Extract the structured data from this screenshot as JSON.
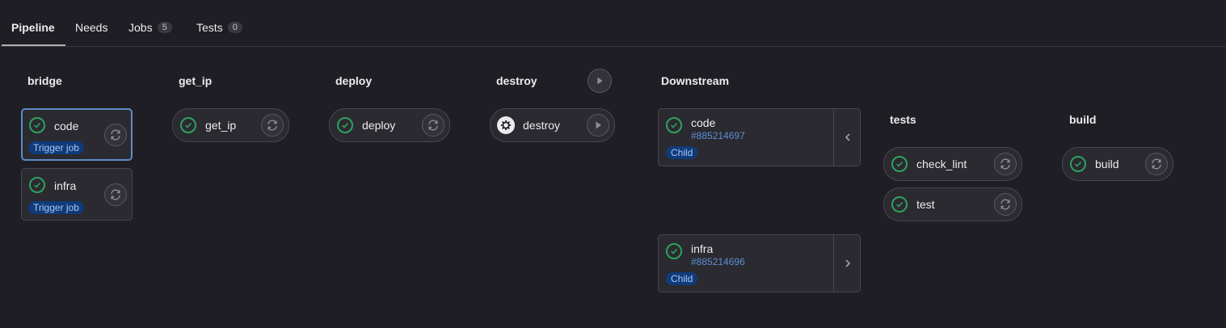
{
  "tabs": [
    {
      "label": "Pipeline"
    },
    {
      "label": "Needs"
    },
    {
      "label": "Jobs",
      "count": "5"
    },
    {
      "label": "Tests",
      "count": "0"
    }
  ],
  "stages": {
    "bridge": {
      "title": "bridge",
      "jobs": [
        {
          "name": "code",
          "badge": "Trigger job"
        },
        {
          "name": "infra",
          "badge": "Trigger job"
        }
      ]
    },
    "get_ip": {
      "title": "get_ip",
      "jobs": [
        {
          "name": "get_ip"
        }
      ]
    },
    "deploy": {
      "title": "deploy",
      "jobs": [
        {
          "name": "deploy"
        }
      ]
    },
    "destroy": {
      "title": "destroy",
      "jobs": [
        {
          "name": "destroy"
        }
      ]
    },
    "downstream": {
      "title": "Downstream",
      "pipelines": [
        {
          "name": "code",
          "id": "#885214697",
          "badge": "Child"
        },
        {
          "name": "infra",
          "id": "#885214696",
          "badge": "Child"
        }
      ]
    },
    "tests": {
      "title": "tests",
      "jobs": [
        {
          "name": "check_lint"
        },
        {
          "name": "test"
        }
      ]
    },
    "build": {
      "title": "build",
      "jobs": [
        {
          "name": "build"
        }
      ]
    }
  },
  "colors": {
    "success": "#2da160",
    "accent": "#5e8bc7",
    "link": "#5b8fd6",
    "background": "#1f1e24"
  },
  "icons": {
    "status": "check-circle-icon",
    "retry": "retry-icon",
    "play": "play-icon",
    "manual": "gear-icon",
    "collapse": "chevron-left-icon",
    "expand": "chevron-right-icon"
  }
}
